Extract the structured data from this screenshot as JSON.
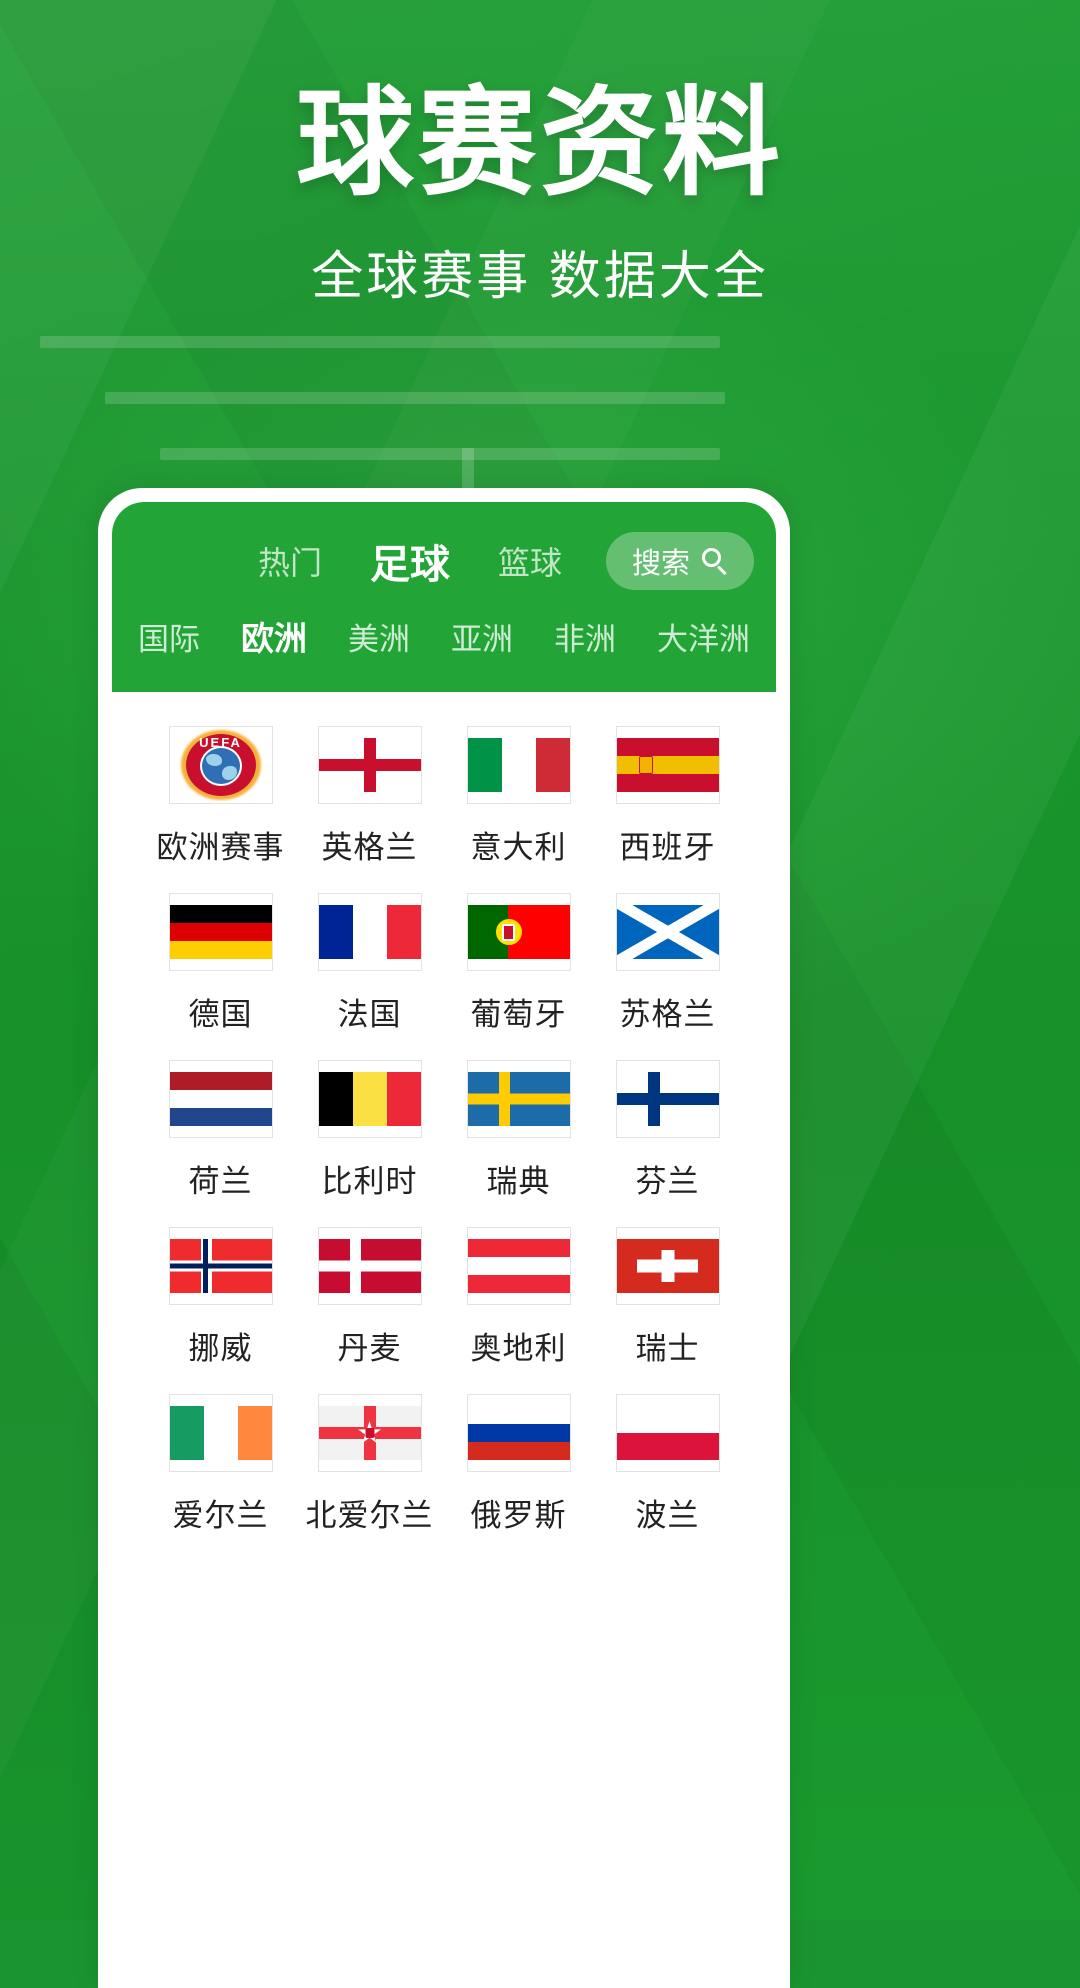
{
  "hero": {
    "title": "球赛资料",
    "subtitle": "全球赛事 数据大全"
  },
  "colors": {
    "brand_green": "#1a9430",
    "appbar_green": "#22a437",
    "white": "#ffffff"
  },
  "app": {
    "top_tabs": [
      {
        "label": "热门",
        "active": false
      },
      {
        "label": "足球",
        "active": true
      },
      {
        "label": "篮球",
        "active": false
      }
    ],
    "search": {
      "label": "搜索",
      "icon": "search-icon"
    },
    "sub_tabs": [
      {
        "label": "国际",
        "active": false
      },
      {
        "label": "欧洲",
        "active": true
      },
      {
        "label": "美洲",
        "active": false
      },
      {
        "label": "亚洲",
        "active": false
      },
      {
        "label": "非洲",
        "active": false
      },
      {
        "label": "大洋洲",
        "active": false
      }
    ],
    "grid": [
      {
        "label": "欧洲赛事",
        "flag": "uefa"
      },
      {
        "label": "英格兰",
        "flag": "england"
      },
      {
        "label": "意大利",
        "flag": "italy"
      },
      {
        "label": "西班牙",
        "flag": "spain"
      },
      {
        "label": "德国",
        "flag": "germany"
      },
      {
        "label": "法国",
        "flag": "france"
      },
      {
        "label": "葡萄牙",
        "flag": "portugal"
      },
      {
        "label": "苏格兰",
        "flag": "scotland"
      },
      {
        "label": "荷兰",
        "flag": "netherlands"
      },
      {
        "label": "比利时",
        "flag": "belgium"
      },
      {
        "label": "瑞典",
        "flag": "sweden"
      },
      {
        "label": "芬兰",
        "flag": "finland"
      },
      {
        "label": "挪威",
        "flag": "norway"
      },
      {
        "label": "丹麦",
        "flag": "denmark"
      },
      {
        "label": "奥地利",
        "flag": "austria"
      },
      {
        "label": "瑞士",
        "flag": "switzerland"
      },
      {
        "label": "爱尔兰",
        "flag": "ireland"
      },
      {
        "label": "北爱尔兰",
        "flag": "northern-ireland"
      },
      {
        "label": "俄罗斯",
        "flag": "russia"
      },
      {
        "label": "波兰",
        "flag": "poland"
      }
    ]
  }
}
